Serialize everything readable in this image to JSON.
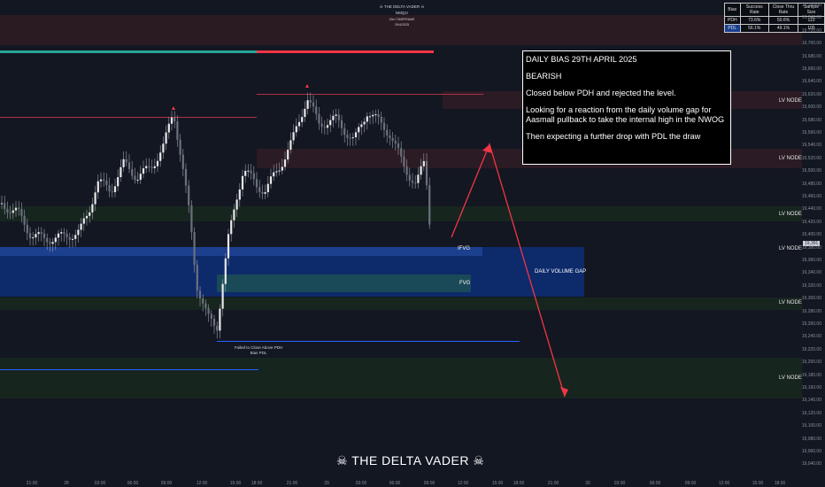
{
  "header": {
    "brand_line": "☠ THE DELTA VADER ☠",
    "symbol": "NMQ1!",
    "timeframe": "15m TIMEFRAME",
    "date": "29/4/2025"
  },
  "stats_table": {
    "headers": [
      "Bias",
      "Success Rate",
      "Close Thru Rate",
      "Sample Size"
    ],
    "rows": [
      [
        "PDH",
        "73.6%",
        "50.6%",
        "110"
      ],
      [
        "PDL",
        "56.1%",
        "49.1%",
        "105"
      ]
    ]
  },
  "bias_box": {
    "title": "DAILY BIAS 29TH APRIL 2025",
    "direction": "BEARISH",
    "line1": "Closed below PDH and rejected the level.",
    "line2": "Looking for a reaction from the daily volume gap for Aasmall pullback to take the internal high in the NWOG",
    "line3": "Then expecting a further drop with PDL the draw"
  },
  "labels": {
    "lv_node": "LV NODE",
    "ifvg": "IFVG",
    "fvg": "FVG",
    "daily_volume_gap": "DAILY VOLUME GAP",
    "failed_line1": "Failed to Close Above PDH",
    "failed_line2": "Bias PDL",
    "brand": "☠ THE DELTA VADER ☠",
    "price_tag": "19,391"
  },
  "y_axis": [
    "19,760.00",
    "19,740.00",
    "19,720.00",
    "19,700.00",
    "19,680.00",
    "19,660.00",
    "19,640.00",
    "19,620.00",
    "19,600.00",
    "19,580.00",
    "19,560.00",
    "19,540.00",
    "19,520.00",
    "19,500.00",
    "19,480.00",
    "19,460.00",
    "19,440.00",
    "19,420.00",
    "19,400.00",
    "19,380.00",
    "19,360.00",
    "19,340.00",
    "19,320.00",
    "19,300.00",
    "19,280.00",
    "19,260.00",
    "19,240.00",
    "19,220.00",
    "19,200.00",
    "19,180.00",
    "19,160.00",
    "19,140.00",
    "19,120.00",
    "19,100.00",
    "19,080.00",
    "19,060.00",
    "19,040.00"
  ],
  "x_axis": [
    "21:00",
    "28",
    "03:00",
    "06:00",
    "09:00",
    "12:00",
    "15:00",
    "18:00",
    "21:00",
    "29",
    "03:00",
    "06:00",
    "09:00",
    "12:00",
    "15:00",
    "18:00",
    "21:00",
    "30",
    "03:00",
    "06:00",
    "09:00",
    "12:00",
    "15:00",
    "18:00"
  ],
  "colors": {
    "background": "#131722",
    "bull_bar": "#26a69a",
    "bear_bar": "#f23645",
    "volume_gap": "#0d2a6b",
    "arrow": "#f23645"
  }
}
